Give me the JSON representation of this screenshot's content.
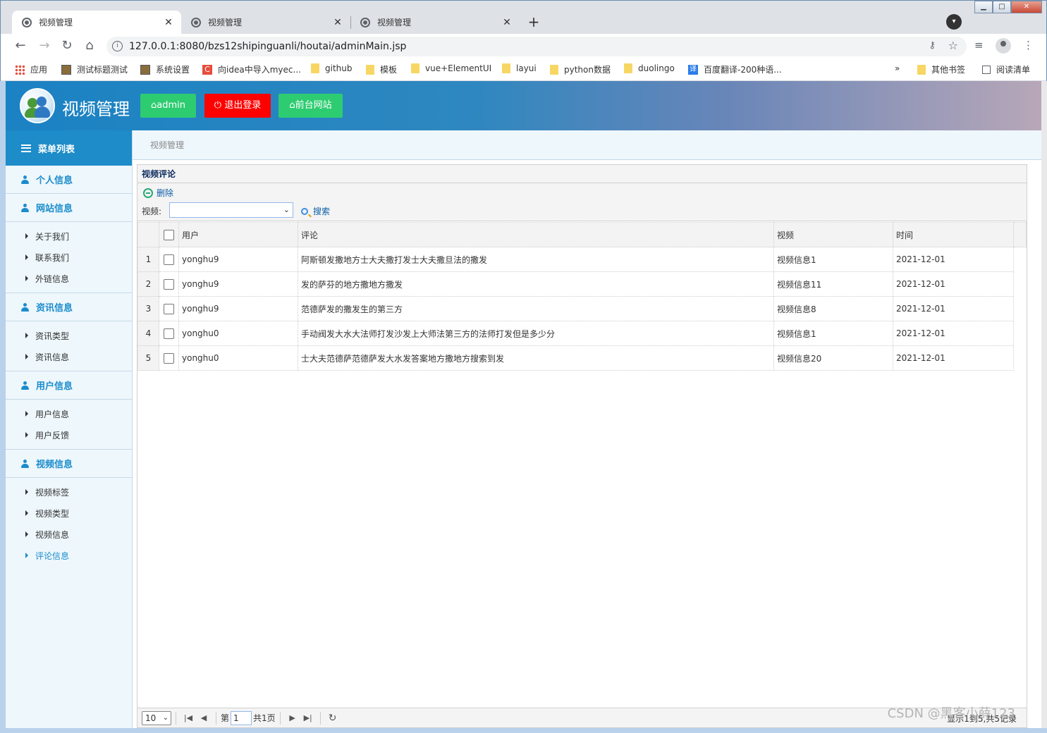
{
  "browser": {
    "tabs": [
      {
        "title": "视频管理",
        "close": "✕"
      },
      {
        "title": "视频管理",
        "close": "✕"
      },
      {
        "title": "视频管理",
        "close": "✕"
      }
    ],
    "new_tab": "+",
    "url": "127.0.0.1:8080/bzs12shipinguanli/houtai/adminMain.jsp",
    "bookmarks": [
      {
        "label": "应用",
        "icon": "apps-icon"
      },
      {
        "label": "测试标题测试",
        "icon": "image-icon"
      },
      {
        "label": "系统设置",
        "icon": "image-icon"
      },
      {
        "label": "向idea中导入myec...",
        "icon": "c-icon"
      },
      {
        "label": "github",
        "icon": "folder-icon"
      },
      {
        "label": "模板",
        "icon": "folder-icon"
      },
      {
        "label": "vue+ElementUI",
        "icon": "folder-icon"
      },
      {
        "label": "layui",
        "icon": "folder-icon"
      },
      {
        "label": "python数据",
        "icon": "folder-icon"
      },
      {
        "label": "duolingo",
        "icon": "folder-icon"
      },
      {
        "label": "百度翻译-200种语...",
        "icon": "translate-icon"
      }
    ],
    "more": "»",
    "other_bookmarks": "其他书签",
    "reading_list": "阅读清单"
  },
  "app": {
    "title": "视频管理",
    "buttons": {
      "admin": "admin",
      "logout": "退出登录",
      "frontend": "前台网站"
    }
  },
  "sidebar": {
    "header": "菜单列表",
    "groups": [
      {
        "label": "个人信息",
        "items": []
      },
      {
        "label": "网站信息",
        "items": [
          "关于我们",
          "联系我们",
          "外链信息"
        ]
      },
      {
        "label": "资讯信息",
        "items": [
          "资讯类型",
          "资讯信息"
        ]
      },
      {
        "label": "用户信息",
        "items": [
          "用户信息",
          "用户反馈"
        ]
      },
      {
        "label": "视频信息",
        "items": [
          "视频标签",
          "视频类型",
          "视频信息",
          "评论信息"
        ]
      }
    ],
    "active_item": "评论信息"
  },
  "breadcrumb": "视频管理",
  "panel": {
    "title": "视频评论",
    "delete_label": "删除",
    "filter_label": "视频:",
    "filter_value": "",
    "search_label": "搜索",
    "columns": [
      "用户",
      "评论",
      "视频",
      "时间"
    ],
    "rows": [
      {
        "n": "1",
        "user": "yonghu9",
        "comment": "阿斯顿发撒地方士大夫撒打发士大夫撒旦法的撒发",
        "video": "视频信息1",
        "time": "2021-12-01"
      },
      {
        "n": "2",
        "user": "yonghu9",
        "comment": "发的萨芬的地方撒地方撒发",
        "video": "视频信息11",
        "time": "2021-12-01"
      },
      {
        "n": "3",
        "user": "yonghu9",
        "comment": "范德萨发的撒发生的第三方",
        "video": "视频信息8",
        "time": "2021-12-01"
      },
      {
        "n": "4",
        "user": "yonghu0",
        "comment": "手动阀发大水大法师打发沙发上大师法第三方的法师打发但是多少分",
        "video": "视频信息1",
        "time": "2021-12-01"
      },
      {
        "n": "5",
        "user": "yonghu0",
        "comment": "士大夫范德萨范德萨发大水发答案地方撒地方搜索到发",
        "video": "视频信息20",
        "time": "2021-12-01"
      }
    ]
  },
  "pager": {
    "page_size": "10",
    "page_prefix": "第",
    "page_value": "1",
    "total_pages": "共1页",
    "info": "显示1到5,共5记录"
  },
  "watermark": "CSDN @黑客小薛123"
}
